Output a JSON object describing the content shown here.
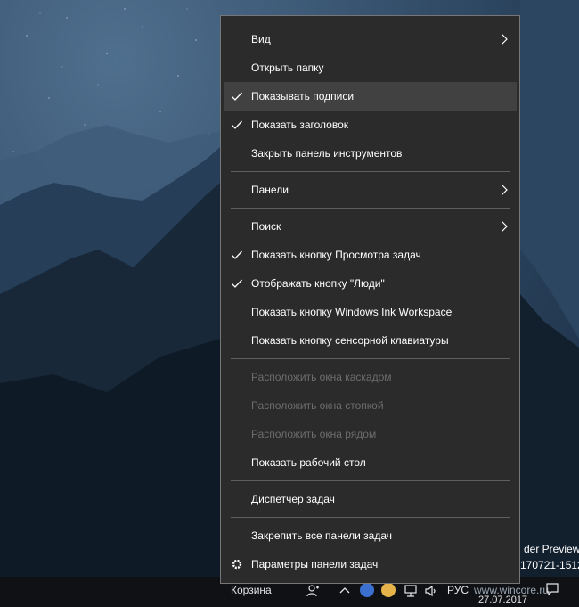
{
  "menu": {
    "items": [
      {
        "label": "Вид",
        "checked": false,
        "submenu": true,
        "disabled": false
      },
      {
        "label": "Открыть папку",
        "checked": false,
        "submenu": false,
        "disabled": false
      },
      {
        "label": "Показывать подписи",
        "checked": true,
        "submenu": false,
        "disabled": false,
        "highlighted": true
      },
      {
        "label": "Показать заголовок",
        "checked": true,
        "submenu": false,
        "disabled": false
      },
      {
        "label": "Закрыть панель инструментов",
        "checked": false,
        "submenu": false,
        "disabled": false
      },
      {
        "label": "Панели",
        "checked": false,
        "submenu": true,
        "disabled": false
      },
      {
        "label": "Поиск",
        "checked": false,
        "submenu": true,
        "disabled": false
      },
      {
        "label": "Показать кнопку Просмотра задач",
        "checked": true,
        "submenu": false,
        "disabled": false
      },
      {
        "label": "Отображать кнопку \"Люди\"",
        "checked": true,
        "submenu": false,
        "disabled": false
      },
      {
        "label": "Показать кнопку Windows Ink Workspace",
        "checked": false,
        "submenu": false,
        "disabled": false
      },
      {
        "label": "Показать кнопку сенсорной клавиатуры",
        "checked": false,
        "submenu": false,
        "disabled": false
      },
      {
        "label": "Расположить окна каскадом",
        "checked": false,
        "submenu": false,
        "disabled": true
      },
      {
        "label": "Расположить окна стопкой",
        "checked": false,
        "submenu": false,
        "disabled": true
      },
      {
        "label": "Расположить окна рядом",
        "checked": false,
        "submenu": false,
        "disabled": true
      },
      {
        "label": "Показать рабочий стол",
        "checked": false,
        "submenu": false,
        "disabled": false
      },
      {
        "label": "Диспетчер задач",
        "checked": false,
        "submenu": false,
        "disabled": false
      },
      {
        "label": "Закрепить все панели задач",
        "checked": false,
        "submenu": false,
        "disabled": false
      },
      {
        "label": "Параметры панели задач",
        "checked": false,
        "submenu": false,
        "disabled": false,
        "icon": "gear-icon"
      }
    ]
  },
  "desktop": {
    "line1": "der Preview",
    "line2": "170721-1512"
  },
  "taskbar": {
    "toolbar_label": "Корзина",
    "language": "РУС",
    "date": "27.07.2017",
    "watermark": "www.wincore.ru"
  },
  "colors": {
    "menu_bg": "#2b2b2b",
    "menu_border": "#767676",
    "highlight_bg": "#414141",
    "disabled_text": "#6d6d6d",
    "taskbar_bg": "#0f1115"
  }
}
